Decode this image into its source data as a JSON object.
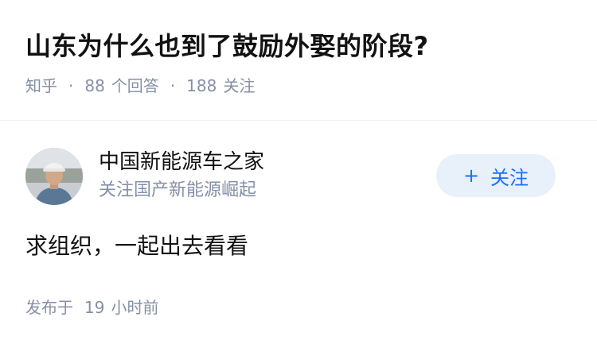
{
  "question": {
    "title": "山东为什么也到了鼓励外娶的阶段?",
    "source": "知乎",
    "answers_count": "88",
    "answers_label": "个回答",
    "followers_count": "188",
    "followers_label": "关注"
  },
  "author": {
    "name": "中国新能源车之家",
    "bio": "关注国产新能源崛起",
    "avatar_icon": "user-avatar-photo"
  },
  "follow_button": {
    "icon": "plus-icon",
    "plus": "+",
    "label": "关注"
  },
  "answer": {
    "content": "求组织，一起出去看看"
  },
  "publish": {
    "label": "发布于",
    "time_num": "19",
    "time_unit": "小时前"
  },
  "colors": {
    "title": "#121212",
    "meta": "#8590a6",
    "follow_bg": "#e8f0fa",
    "follow_text": "#1772f6"
  }
}
